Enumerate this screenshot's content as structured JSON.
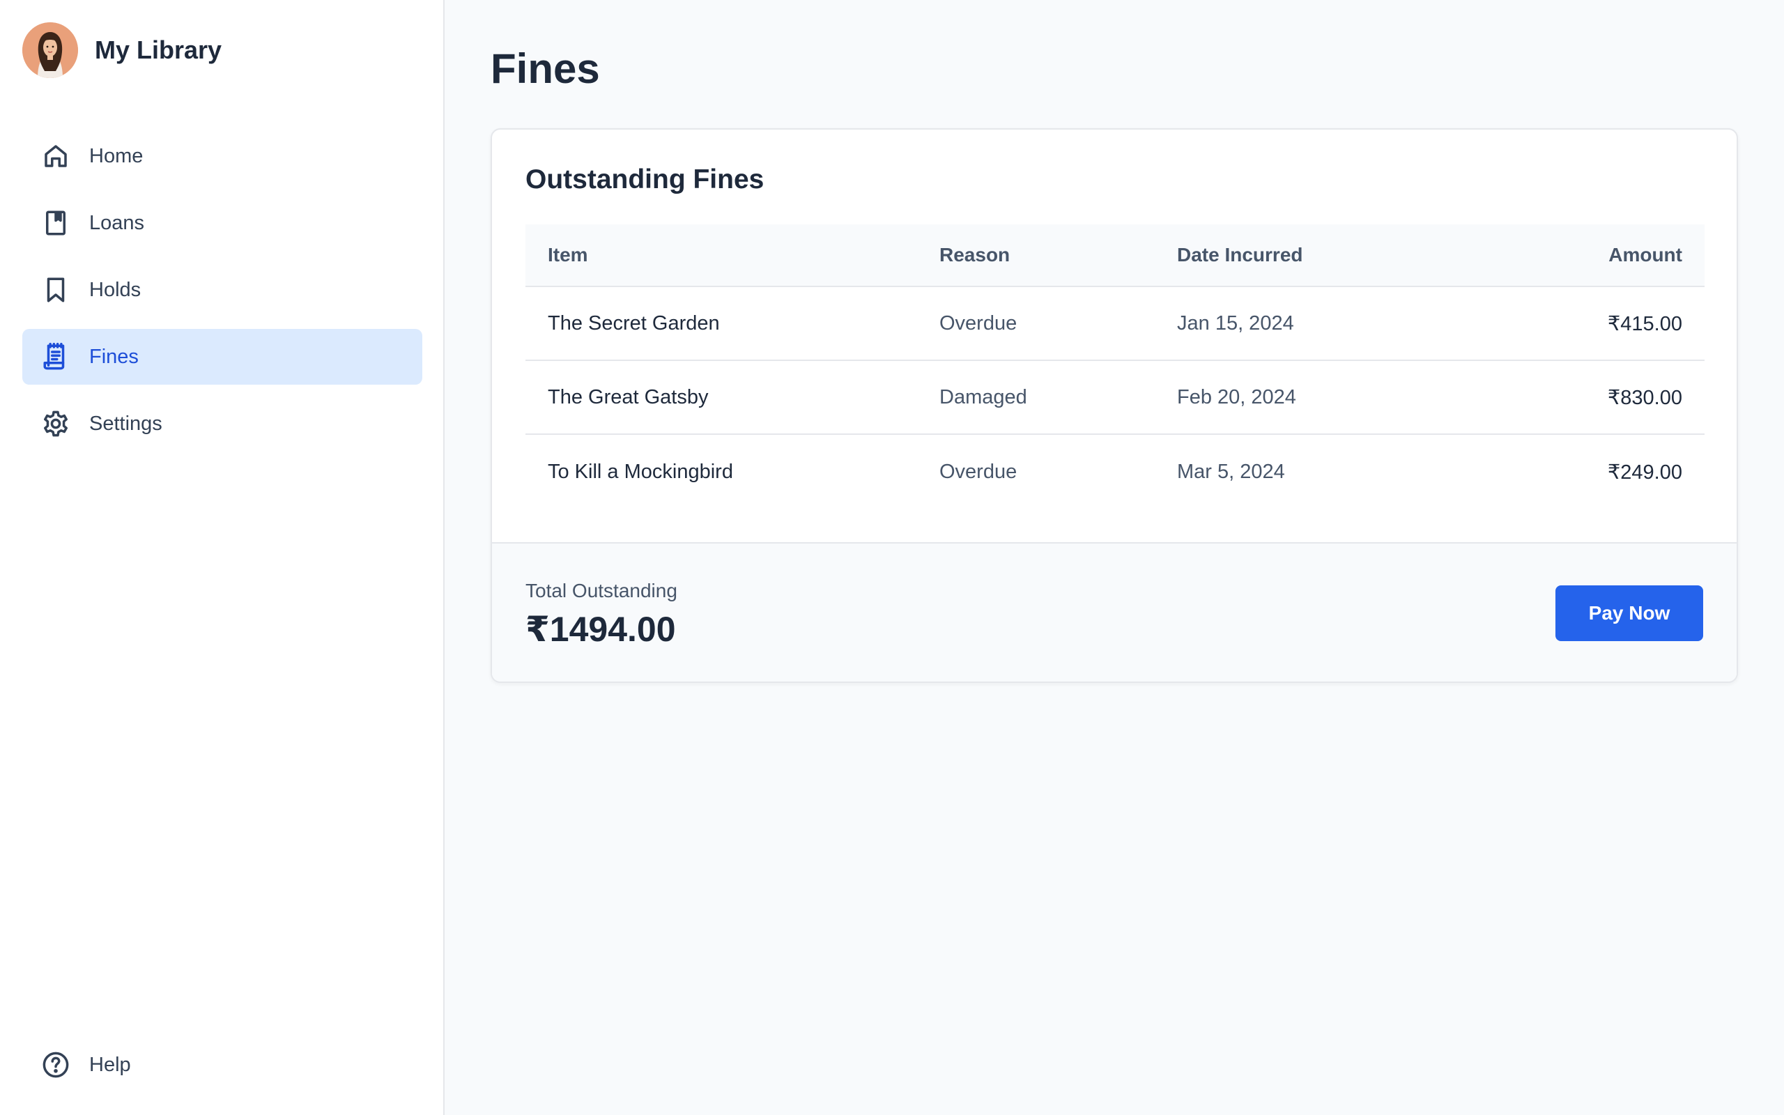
{
  "brand": {
    "title": "My Library"
  },
  "nav": [
    {
      "label": "Home",
      "icon": "home-icon"
    },
    {
      "label": "Loans",
      "icon": "book-icon"
    },
    {
      "label": "Holds",
      "icon": "bookmark-icon"
    },
    {
      "label": "Fines",
      "icon": "receipt-icon",
      "active": true
    },
    {
      "label": "Settings",
      "icon": "gear-icon"
    }
  ],
  "help": {
    "label": "Help",
    "icon": "help-icon"
  },
  "page": {
    "title": "Fines"
  },
  "card": {
    "title": "Outstanding Fines",
    "columns": {
      "item": "Item",
      "reason": "Reason",
      "date": "Date Incurred",
      "amount": "Amount"
    },
    "rows": [
      {
        "item": "The Secret Garden",
        "reason": "Overdue",
        "date": "Jan 15, 2024",
        "amount": "₹415.00"
      },
      {
        "item": "The Great Gatsby",
        "reason": "Damaged",
        "date": "Feb 20, 2024",
        "amount": "₹830.00"
      },
      {
        "item": "To Kill a Mockingbird",
        "reason": "Overdue",
        "date": "Mar 5, 2024",
        "amount": "₹249.00"
      }
    ],
    "total_label": "Total Outstanding",
    "total_value": "₹1494.00",
    "pay_label": "Pay Now"
  },
  "colors": {
    "accent": "#2563eb",
    "active_bg": "#dbeafe",
    "active_text": "#1d4ed8",
    "text": "#1e293b",
    "muted": "#475569"
  }
}
